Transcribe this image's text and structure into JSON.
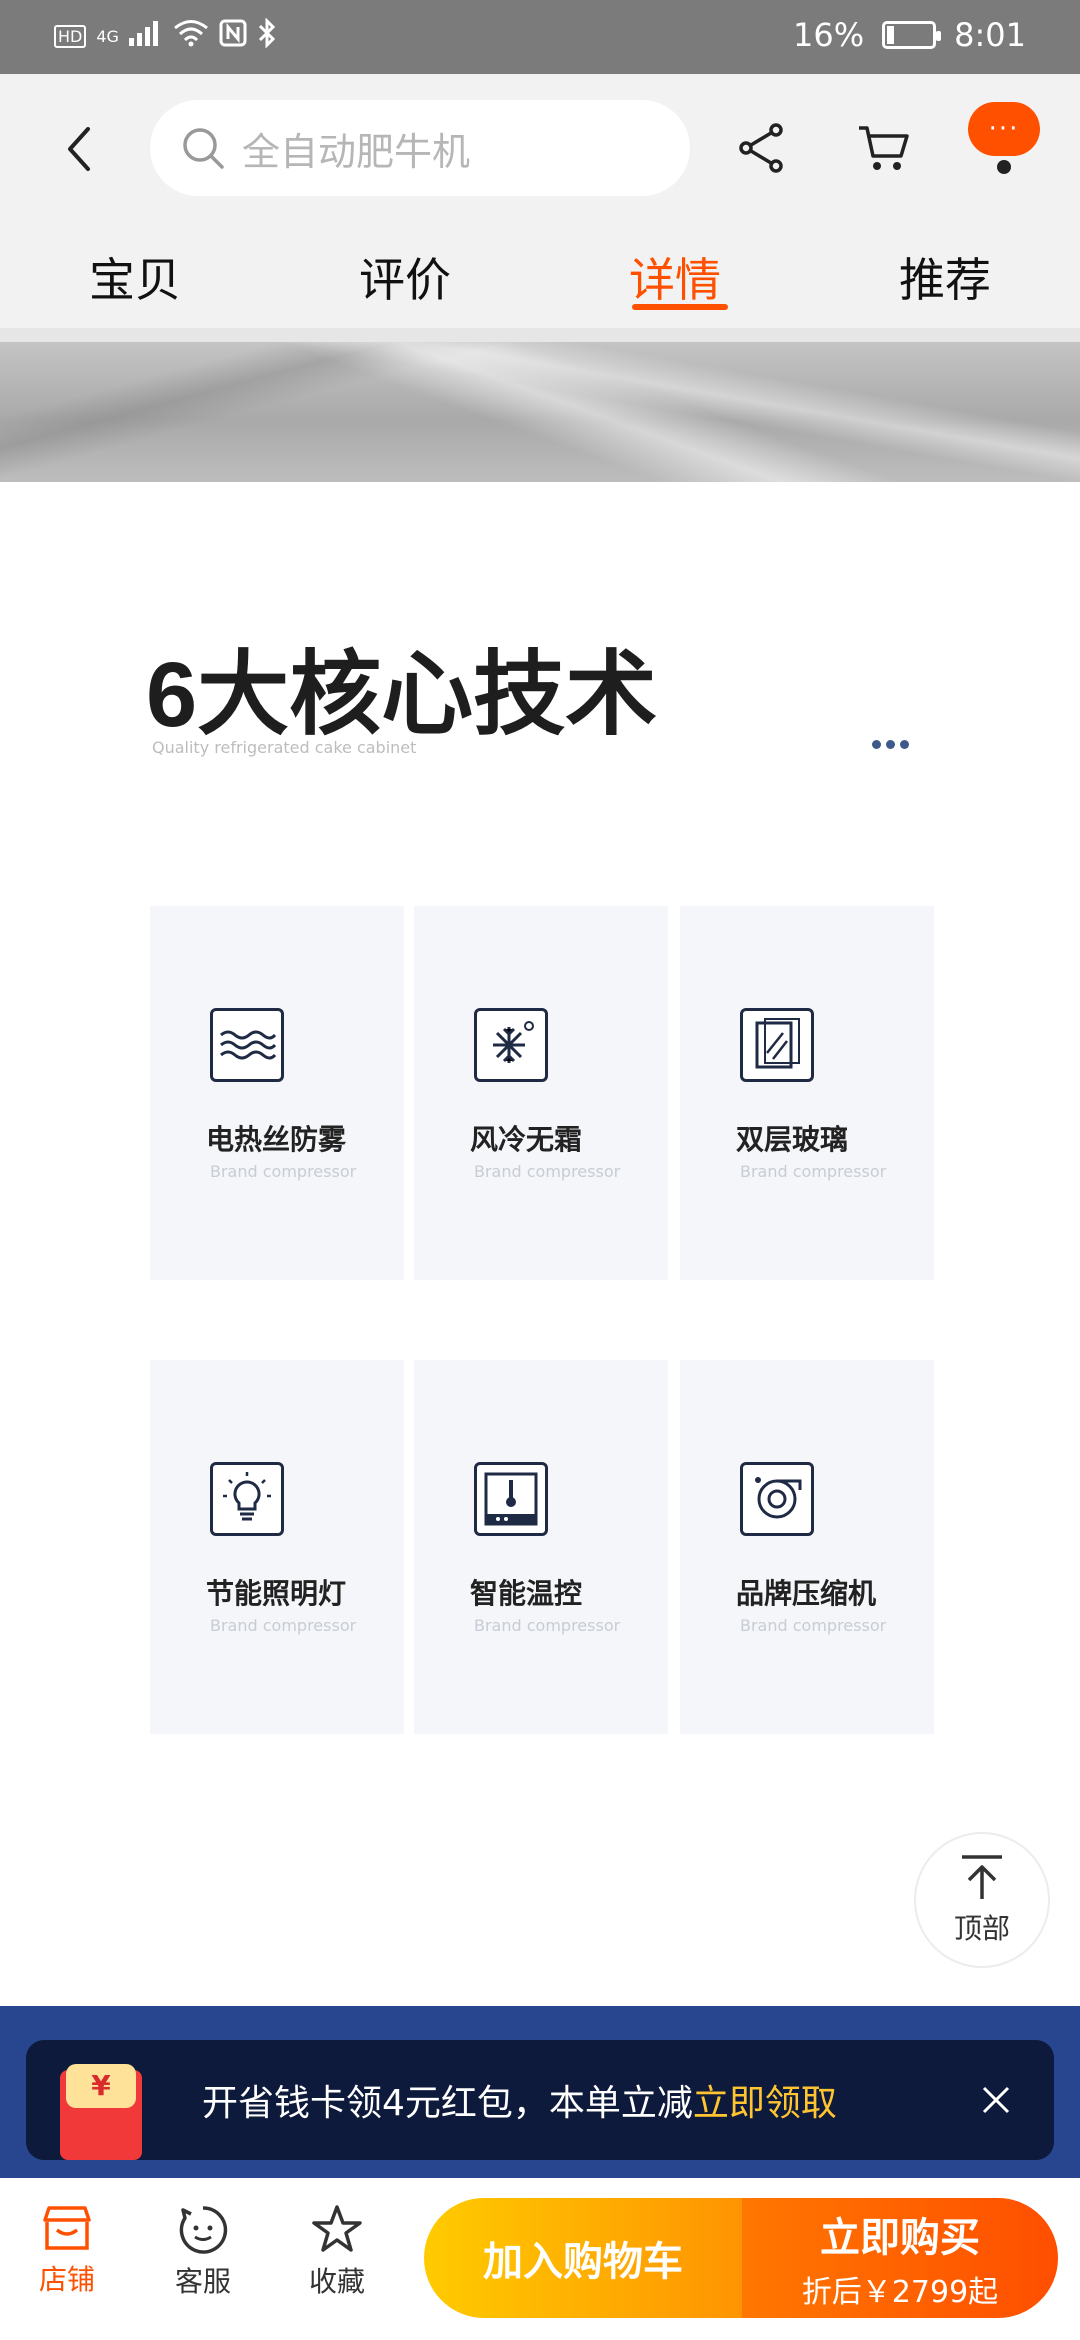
{
  "status_bar": {
    "left_labels": [
      "HD",
      "4G"
    ],
    "battery": "16%",
    "battery_level": 0.16,
    "time": "8:01"
  },
  "header": {
    "search_placeholder": "全自动肥牛机",
    "more_label": "···",
    "accent_color": "#ff5000"
  },
  "tabs": [
    {
      "label": "宝贝",
      "active": false
    },
    {
      "label": "评价",
      "active": false
    },
    {
      "label": "详情",
      "active": true
    },
    {
      "label": "推荐",
      "active": false
    }
  ],
  "section": {
    "title": "6大核心技术",
    "subtitle": "Quality refrigerated cake cabinet"
  },
  "features": [
    {
      "name": "电热丝防雾",
      "en": "Brand compressor",
      "icon": "waves-icon"
    },
    {
      "name": "风冷无霜",
      "en": "Brand compressor",
      "icon": "snowflake-icon"
    },
    {
      "name": "双层玻璃",
      "en": "Brand compressor",
      "icon": "glass-icon"
    },
    {
      "name": "节能照明灯",
      "en": "Brand compressor",
      "icon": "lightbulb-icon"
    },
    {
      "name": "智能温控",
      "en": "Brand compressor",
      "icon": "thermometer-icon"
    },
    {
      "name": "品牌压缩机",
      "en": "Brand compressor",
      "icon": "compressor-icon"
    }
  ],
  "top_button": {
    "label": "顶部"
  },
  "promo": {
    "envelope_symbol": "¥",
    "text": "开省钱卡领4元红包，本单立减",
    "highlight": "立即领取"
  },
  "bottom_bar": {
    "store": "店铺",
    "service": "客服",
    "favorite": "收藏",
    "add_to_cart": "加入购物车",
    "buy_now": "立即购买",
    "buy_sub": "折后￥2799起"
  }
}
